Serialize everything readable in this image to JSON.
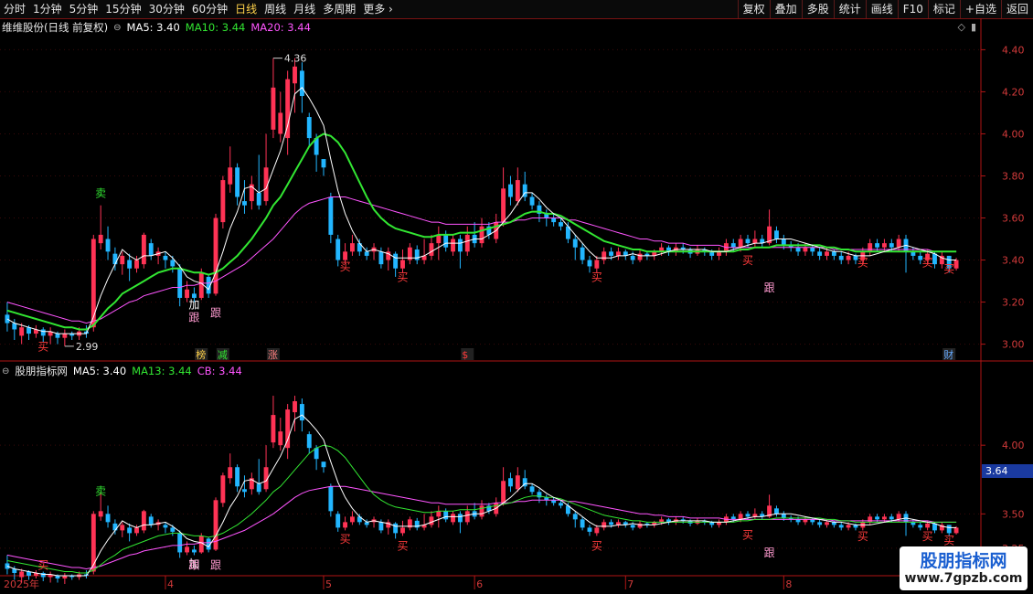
{
  "toolbar": {
    "periods": [
      {
        "label": "分时",
        "active": false
      },
      {
        "label": "1分钟",
        "active": false
      },
      {
        "label": "5分钟",
        "active": false
      },
      {
        "label": "15分钟",
        "active": false
      },
      {
        "label": "30分钟",
        "active": false
      },
      {
        "label": "60分钟",
        "active": false
      },
      {
        "label": "日线",
        "active": true
      },
      {
        "label": "周线",
        "active": false
      },
      {
        "label": "月线",
        "active": false
      },
      {
        "label": "多周期",
        "active": false
      },
      {
        "label": "更多",
        "active": false
      }
    ],
    "actions": [
      "复权",
      "叠加",
      "多股",
      "统计",
      "画线",
      "F10",
      "标记",
      "+自选",
      "返回"
    ]
  },
  "main_panel": {
    "title": "维维股份(日线 前复权)",
    "ma5": "MA5: 3.40",
    "ma10": "MA10: 3.44",
    "ma20": "MA20: 3.44",
    "price_ticks": [
      "4.40",
      "4.20",
      "4.00",
      "3.80",
      "3.60",
      "3.40",
      "3.20",
      "3.00"
    ],
    "high_label": "4.36",
    "low_label": "2.99",
    "event_markers": [
      {
        "text": "榜",
        "color": "#ffd24a"
      },
      {
        "text": "减",
        "color": "#32e632"
      },
      {
        "text": "涨",
        "color": "#ff8080"
      },
      {
        "text": "$",
        "color": "#ff3b3b"
      },
      {
        "text": "财",
        "color": "#66aaff"
      }
    ]
  },
  "sub_panel": {
    "title": "股朋指标网",
    "ma5": "MA5: 3.40",
    "ma13": "MA13: 3.44",
    "cb": "CB: 3.44",
    "price_ticks": [
      "4.00",
      "3.50",
      "3.25"
    ],
    "current_price_tag": "3.64"
  },
  "signals": {
    "buy": "买",
    "sell": "卖",
    "add": "加",
    "follow": "跟"
  },
  "x_axis": {
    "labels": [
      "2025年",
      "4",
      "5",
      "6",
      "7",
      "8"
    ]
  },
  "logo": {
    "name": "股朋指标网",
    "url_text": "www.7gpzb.com"
  },
  "colors": {
    "up": "#ff3355",
    "down": "#22b6ff",
    "ma5": "#ffffff",
    "ma10": "#32e632",
    "ma20": "#ff55ff",
    "axis": "#b01515"
  },
  "chart_data": {
    "type": "candlestick",
    "axis_range": {
      "ylim_main": [
        2.92,
        4.48
      ]
    },
    "candles": [
      {
        "o": 3.14,
        "c": 3.1,
        "h": 3.2,
        "l": 3.06
      },
      {
        "o": 3.1,
        "c": 3.07,
        "h": 3.12,
        "l": 3.02
      },
      {
        "o": 3.04,
        "c": 3.08,
        "h": 3.1,
        "l": 3.0
      },
      {
        "o": 3.08,
        "c": 3.05,
        "h": 3.09,
        "l": 3.02
      },
      {
        "o": 3.05,
        "c": 3.07,
        "h": 3.09,
        "l": 3.03
      },
      {
        "o": 3.07,
        "c": 3.04,
        "h": 3.08,
        "l": 3.01
      },
      {
        "o": 3.04,
        "c": 3.06,
        "h": 3.08,
        "l": 3.0
      },
      {
        "o": 3.05,
        "c": 3.03,
        "h": 3.06,
        "l": 3.0
      },
      {
        "o": 3.03,
        "c": 3.05,
        "h": 3.07,
        "l": 2.99
      },
      {
        "o": 3.05,
        "c": 3.04,
        "h": 3.06,
        "l": 3.02
      },
      {
        "o": 3.04,
        "c": 3.06,
        "h": 3.08,
        "l": 3.02
      },
      {
        "o": 3.06,
        "c": 3.05,
        "h": 3.09,
        "l": 3.03
      },
      {
        "o": 3.08,
        "c": 3.5,
        "h": 3.52,
        "l": 3.06
      },
      {
        "o": 3.48,
        "c": 3.52,
        "h": 3.66,
        "l": 3.45
      },
      {
        "o": 3.5,
        "c": 3.44,
        "h": 3.56,
        "l": 3.4
      },
      {
        "o": 3.43,
        "c": 3.38,
        "h": 3.46,
        "l": 3.35
      },
      {
        "o": 3.38,
        "c": 3.42,
        "h": 3.44,
        "l": 3.33
      },
      {
        "o": 3.4,
        "c": 3.36,
        "h": 3.43,
        "l": 3.3
      },
      {
        "o": 3.36,
        "c": 3.4,
        "h": 3.42,
        "l": 3.34
      },
      {
        "o": 3.38,
        "c": 3.52,
        "h": 3.53,
        "l": 3.36
      },
      {
        "o": 3.48,
        "c": 3.42,
        "h": 3.5,
        "l": 3.4
      },
      {
        "o": 3.42,
        "c": 3.44,
        "h": 3.46,
        "l": 3.38
      },
      {
        "o": 3.42,
        "c": 3.4,
        "h": 3.44,
        "l": 3.36
      },
      {
        "o": 3.4,
        "c": 3.37,
        "h": 3.42,
        "l": 3.34
      },
      {
        "o": 3.36,
        "c": 3.22,
        "h": 3.38,
        "l": 3.18
      },
      {
        "o": 3.22,
        "c": 3.26,
        "h": 3.3,
        "l": 3.2
      },
      {
        "o": 3.24,
        "c": 3.22,
        "h": 3.27,
        "l": 3.2
      },
      {
        "o": 3.22,
        "c": 3.34,
        "h": 3.36,
        "l": 3.21
      },
      {
        "o": 3.32,
        "c": 3.24,
        "h": 3.33,
        "l": 3.22
      },
      {
        "o": 3.24,
        "c": 3.6,
        "h": 3.62,
        "l": 3.23
      },
      {
        "o": 3.58,
        "c": 3.78,
        "h": 3.8,
        "l": 3.55
      },
      {
        "o": 3.76,
        "c": 3.84,
        "h": 3.94,
        "l": 3.72
      },
      {
        "o": 3.84,
        "c": 3.7,
        "h": 3.86,
        "l": 3.66
      },
      {
        "o": 3.68,
        "c": 3.66,
        "h": 3.78,
        "l": 3.62
      },
      {
        "o": 3.68,
        "c": 3.76,
        "h": 3.8,
        "l": 3.64
      },
      {
        "o": 3.72,
        "c": 3.66,
        "h": 3.9,
        "l": 3.64
      },
      {
        "o": 3.68,
        "c": 3.84,
        "h": 4.0,
        "l": 3.66
      },
      {
        "o": 4.02,
        "c": 4.22,
        "h": 4.36,
        "l": 3.98
      },
      {
        "o": 4.0,
        "c": 4.1,
        "h": 4.2,
        "l": 3.96
      },
      {
        "o": 3.98,
        "c": 4.26,
        "h": 4.3,
        "l": 3.9
      },
      {
        "o": 4.24,
        "c": 4.32,
        "h": 4.36,
        "l": 4.1
      },
      {
        "o": 4.3,
        "c": 4.18,
        "h": 4.34,
        "l": 4.1
      },
      {
        "o": 4.08,
        "c": 3.98,
        "h": 4.1,
        "l": 3.94
      },
      {
        "o": 3.98,
        "c": 3.9,
        "h": 4.0,
        "l": 3.82
      },
      {
        "o": 3.88,
        "c": 3.84,
        "h": 3.88,
        "l": 3.8
      },
      {
        "o": 3.7,
        "c": 3.52,
        "h": 3.72,
        "l": 3.48
      },
      {
        "o": 3.5,
        "c": 3.4,
        "h": 3.52,
        "l": 3.37
      },
      {
        "o": 3.4,
        "c": 3.44,
        "h": 3.48,
        "l": 3.38
      },
      {
        "o": 3.44,
        "c": 3.48,
        "h": 3.52,
        "l": 3.42
      },
      {
        "o": 3.48,
        "c": 3.44,
        "h": 3.5,
        "l": 3.42
      },
      {
        "o": 3.44,
        "c": 3.42,
        "h": 3.46,
        "l": 3.4
      },
      {
        "o": 3.44,
        "c": 3.46,
        "h": 3.48,
        "l": 3.4
      },
      {
        "o": 3.44,
        "c": 3.38,
        "h": 3.46,
        "l": 3.36
      },
      {
        "o": 3.4,
        "c": 3.44,
        "h": 3.46,
        "l": 3.35
      },
      {
        "o": 3.43,
        "c": 3.36,
        "h": 3.44,
        "l": 3.32
      },
      {
        "o": 3.36,
        "c": 3.4,
        "h": 3.45,
        "l": 3.34
      },
      {
        "o": 3.4,
        "c": 3.46,
        "h": 3.48,
        "l": 3.38
      },
      {
        "o": 3.45,
        "c": 3.4,
        "h": 3.47,
        "l": 3.38
      },
      {
        "o": 3.4,
        "c": 3.42,
        "h": 3.5,
        "l": 3.38
      },
      {
        "o": 3.42,
        "c": 3.48,
        "h": 3.52,
        "l": 3.4
      },
      {
        "o": 3.48,
        "c": 3.52,
        "h": 3.56,
        "l": 3.4
      },
      {
        "o": 3.52,
        "c": 3.46,
        "h": 3.54,
        "l": 3.44
      },
      {
        "o": 3.44,
        "c": 3.5,
        "h": 3.52,
        "l": 3.42
      },
      {
        "o": 3.5,
        "c": 3.44,
        "h": 3.52,
        "l": 3.36
      },
      {
        "o": 3.44,
        "c": 3.52,
        "h": 3.56,
        "l": 3.42
      },
      {
        "o": 3.52,
        "c": 3.48,
        "h": 3.58,
        "l": 3.46
      },
      {
        "o": 3.48,
        "c": 3.56,
        "h": 3.6,
        "l": 3.46
      },
      {
        "o": 3.56,
        "c": 3.52,
        "h": 3.58,
        "l": 3.5
      },
      {
        "o": 3.5,
        "c": 3.58,
        "h": 3.62,
        "l": 3.48
      },
      {
        "o": 3.58,
        "c": 3.74,
        "h": 3.84,
        "l": 3.56
      },
      {
        "o": 3.76,
        "c": 3.7,
        "h": 3.8,
        "l": 3.66
      },
      {
        "o": 3.68,
        "c": 3.78,
        "h": 3.84,
        "l": 3.66
      },
      {
        "o": 3.76,
        "c": 3.7,
        "h": 3.82,
        "l": 3.68
      },
      {
        "o": 3.7,
        "c": 3.66,
        "h": 3.72,
        "l": 3.64
      },
      {
        "o": 3.66,
        "c": 3.62,
        "h": 3.68,
        "l": 3.58
      },
      {
        "o": 3.62,
        "c": 3.6,
        "h": 3.64,
        "l": 3.56
      },
      {
        "o": 3.6,
        "c": 3.58,
        "h": 3.62,
        "l": 3.56
      },
      {
        "o": 3.58,
        "c": 3.56,
        "h": 3.6,
        "l": 3.54
      },
      {
        "o": 3.56,
        "c": 3.5,
        "h": 3.58,
        "l": 3.48
      },
      {
        "o": 3.5,
        "c": 3.46,
        "h": 3.52,
        "l": 3.4
      },
      {
        "o": 3.46,
        "c": 3.4,
        "h": 3.48,
        "l": 3.38
      },
      {
        "o": 3.4,
        "c": 3.37,
        "h": 3.42,
        "l": 3.34
      },
      {
        "o": 3.36,
        "c": 3.4,
        "h": 3.42,
        "l": 3.34
      },
      {
        "o": 3.4,
        "c": 3.44,
        "h": 3.46,
        "l": 3.38
      },
      {
        "o": 3.44,
        "c": 3.42,
        "h": 3.46,
        "l": 3.4
      },
      {
        "o": 3.42,
        "c": 3.44,
        "h": 3.46,
        "l": 3.4
      },
      {
        "o": 3.44,
        "c": 3.42,
        "h": 3.45,
        "l": 3.4
      },
      {
        "o": 3.42,
        "c": 3.4,
        "h": 3.44,
        "l": 3.38
      },
      {
        "o": 3.4,
        "c": 3.43,
        "h": 3.45,
        "l": 3.39
      },
      {
        "o": 3.43,
        "c": 3.42,
        "h": 3.44,
        "l": 3.4
      },
      {
        "o": 3.42,
        "c": 3.44,
        "h": 3.45,
        "l": 3.4
      },
      {
        "o": 3.44,
        "c": 3.46,
        "h": 3.48,
        "l": 3.42
      },
      {
        "o": 3.46,
        "c": 3.44,
        "h": 3.47,
        "l": 3.42
      },
      {
        "o": 3.44,
        "c": 3.46,
        "h": 3.48,
        "l": 3.42
      },
      {
        "o": 3.46,
        "c": 3.45,
        "h": 3.48,
        "l": 3.43
      },
      {
        "o": 3.45,
        "c": 3.43,
        "h": 3.46,
        "l": 3.41
      },
      {
        "o": 3.43,
        "c": 3.45,
        "h": 3.47,
        "l": 3.42
      },
      {
        "o": 3.45,
        "c": 3.44,
        "h": 3.46,
        "l": 3.42
      },
      {
        "o": 3.44,
        "c": 3.42,
        "h": 3.45,
        "l": 3.4
      },
      {
        "o": 3.42,
        "c": 3.44,
        "h": 3.46,
        "l": 3.4
      },
      {
        "o": 3.44,
        "c": 3.48,
        "h": 3.5,
        "l": 3.42
      },
      {
        "o": 3.48,
        "c": 3.46,
        "h": 3.5,
        "l": 3.44
      },
      {
        "o": 3.46,
        "c": 3.5,
        "h": 3.52,
        "l": 3.44
      },
      {
        "o": 3.5,
        "c": 3.48,
        "h": 3.52,
        "l": 3.46
      },
      {
        "o": 3.48,
        "c": 3.5,
        "h": 3.54,
        "l": 3.46
      },
      {
        "o": 3.5,
        "c": 3.48,
        "h": 3.52,
        "l": 3.46
      },
      {
        "o": 3.48,
        "c": 3.56,
        "h": 3.64,
        "l": 3.47
      },
      {
        "o": 3.54,
        "c": 3.5,
        "h": 3.56,
        "l": 3.48
      },
      {
        "o": 3.5,
        "c": 3.47,
        "h": 3.52,
        "l": 3.45
      },
      {
        "o": 3.47,
        "c": 3.46,
        "h": 3.49,
        "l": 3.44
      },
      {
        "o": 3.46,
        "c": 3.44,
        "h": 3.48,
        "l": 3.42
      },
      {
        "o": 3.44,
        "c": 3.46,
        "h": 3.48,
        "l": 3.42
      },
      {
        "o": 3.46,
        "c": 3.44,
        "h": 3.47,
        "l": 3.42
      },
      {
        "o": 3.44,
        "c": 3.42,
        "h": 3.46,
        "l": 3.4
      },
      {
        "o": 3.42,
        "c": 3.44,
        "h": 3.46,
        "l": 3.4
      },
      {
        "o": 3.44,
        "c": 3.42,
        "h": 3.45,
        "l": 3.4
      },
      {
        "o": 3.42,
        "c": 3.4,
        "h": 3.44,
        "l": 3.38
      },
      {
        "o": 3.4,
        "c": 3.42,
        "h": 3.44,
        "l": 3.38
      },
      {
        "o": 3.42,
        "c": 3.4,
        "h": 3.43,
        "l": 3.38
      },
      {
        "o": 3.4,
        "c": 3.44,
        "h": 3.46,
        "l": 3.38
      },
      {
        "o": 3.44,
        "c": 3.48,
        "h": 3.5,
        "l": 3.42
      },
      {
        "o": 3.48,
        "c": 3.46,
        "h": 3.5,
        "l": 3.44
      },
      {
        "o": 3.46,
        "c": 3.48,
        "h": 3.5,
        "l": 3.44
      },
      {
        "o": 3.48,
        "c": 3.46,
        "h": 3.5,
        "l": 3.44
      },
      {
        "o": 3.46,
        "c": 3.5,
        "h": 3.52,
        "l": 3.44
      },
      {
        "o": 3.5,
        "c": 3.44,
        "h": 3.52,
        "l": 3.34
      },
      {
        "o": 3.44,
        "c": 3.42,
        "h": 3.46,
        "l": 3.4
      },
      {
        "o": 3.42,
        "c": 3.4,
        "h": 3.44,
        "l": 3.38
      },
      {
        "o": 3.4,
        "c": 3.43,
        "h": 3.45,
        "l": 3.38
      },
      {
        "o": 3.43,
        "c": 3.38,
        "h": 3.44,
        "l": 3.36
      },
      {
        "o": 3.38,
        "c": 3.42,
        "h": 3.44,
        "l": 3.36
      },
      {
        "o": 3.42,
        "c": 3.36,
        "h": 3.42,
        "l": 3.34
      },
      {
        "o": 3.36,
        "c": 3.4,
        "h": 3.41,
        "l": 3.35
      }
    ],
    "ma5_values": [
      3.12,
      3.1,
      3.09,
      3.08,
      3.07,
      3.06,
      3.06,
      3.05,
      3.05,
      3.05,
      3.05,
      3.05,
      3.13,
      3.23,
      3.31,
      3.38,
      3.45,
      3.42,
      3.4,
      3.42,
      3.42,
      3.43,
      3.44,
      3.41,
      3.37,
      3.32,
      3.3,
      3.29,
      3.26,
      3.34,
      3.44,
      3.55,
      3.63,
      3.74,
      3.75,
      3.72,
      3.74,
      3.83,
      3.92,
      4.04,
      4.19,
      4.22,
      4.17,
      4.11,
      4.04,
      3.88,
      3.73,
      3.62,
      3.54,
      3.48,
      3.44,
      3.45,
      3.44,
      3.43,
      3.41,
      3.41,
      3.41,
      3.41,
      3.42,
      3.44,
      3.46,
      3.48,
      3.48,
      3.48,
      3.49,
      3.5,
      3.5,
      3.52,
      3.54,
      3.58,
      3.62,
      3.67,
      3.72,
      3.72,
      3.69,
      3.65,
      3.62,
      3.6,
      3.56,
      3.52,
      3.48,
      3.44,
      3.41,
      3.41,
      3.41,
      3.42,
      3.42,
      3.43,
      3.42,
      3.42,
      3.42,
      3.43,
      3.44,
      3.45,
      3.45,
      3.45,
      3.45,
      3.45,
      3.44,
      3.44,
      3.44,
      3.45,
      3.46,
      3.47,
      3.48,
      3.48,
      3.49,
      3.5,
      3.5,
      3.5,
      3.49,
      3.48,
      3.47,
      3.46,
      3.45,
      3.44,
      3.44,
      3.43,
      3.42,
      3.42,
      3.42,
      3.43,
      3.44,
      3.45,
      3.46,
      3.47,
      3.46,
      3.45,
      3.44,
      3.43,
      3.41,
      3.4,
      3.4
    ],
    "ma10_values": [
      3.16,
      3.15,
      3.14,
      3.13,
      3.12,
      3.11,
      3.1,
      3.09,
      3.08,
      3.08,
      3.07,
      3.07,
      3.09,
      3.13,
      3.17,
      3.2,
      3.24,
      3.26,
      3.28,
      3.3,
      3.32,
      3.34,
      3.35,
      3.36,
      3.36,
      3.35,
      3.34,
      3.34,
      3.33,
      3.34,
      3.36,
      3.39,
      3.42,
      3.46,
      3.5,
      3.55,
      3.6,
      3.66,
      3.7,
      3.76,
      3.82,
      3.88,
      3.94,
      3.98,
      4.0,
      3.99,
      3.96,
      3.91,
      3.84,
      3.77,
      3.7,
      3.64,
      3.6,
      3.57,
      3.55,
      3.54,
      3.53,
      3.52,
      3.51,
      3.51,
      3.52,
      3.52,
      3.52,
      3.53,
      3.53,
      3.53,
      3.54,
      3.55,
      3.56,
      3.57,
      3.58,
      3.6,
      3.62,
      3.63,
      3.63,
      3.62,
      3.62,
      3.61,
      3.59,
      3.57,
      3.55,
      3.53,
      3.51,
      3.49,
      3.48,
      3.47,
      3.46,
      3.45,
      3.45,
      3.44,
      3.44,
      3.44,
      3.44,
      3.44,
      3.44,
      3.44,
      3.44,
      3.44,
      3.44,
      3.44,
      3.44,
      3.44,
      3.45,
      3.45,
      3.46,
      3.46,
      3.46,
      3.47,
      3.47,
      3.47,
      3.47,
      3.47,
      3.47,
      3.47,
      3.46,
      3.46,
      3.45,
      3.45,
      3.44,
      3.44,
      3.44,
      3.44,
      3.44,
      3.44,
      3.44,
      3.44,
      3.44,
      3.44,
      3.44,
      3.44,
      3.44,
      3.44,
      3.44
    ],
    "ma20_values": [
      3.2,
      3.19,
      3.18,
      3.17,
      3.16,
      3.15,
      3.14,
      3.13,
      3.12,
      3.11,
      3.11,
      3.1,
      3.11,
      3.12,
      3.14,
      3.16,
      3.18,
      3.2,
      3.21,
      3.23,
      3.24,
      3.25,
      3.26,
      3.27,
      3.27,
      3.28,
      3.28,
      3.29,
      3.29,
      3.3,
      3.32,
      3.34,
      3.36,
      3.38,
      3.41,
      3.44,
      3.47,
      3.5,
      3.54,
      3.58,
      3.62,
      3.65,
      3.67,
      3.68,
      3.69,
      3.7,
      3.7,
      3.7,
      3.69,
      3.68,
      3.67,
      3.66,
      3.65,
      3.64,
      3.63,
      3.62,
      3.61,
      3.6,
      3.59,
      3.58,
      3.58,
      3.57,
      3.57,
      3.57,
      3.57,
      3.57,
      3.57,
      3.57,
      3.58,
      3.58,
      3.58,
      3.59,
      3.59,
      3.6,
      3.6,
      3.6,
      3.6,
      3.6,
      3.59,
      3.59,
      3.58,
      3.57,
      3.56,
      3.55,
      3.54,
      3.53,
      3.52,
      3.51,
      3.5,
      3.5,
      3.49,
      3.49,
      3.48,
      3.48,
      3.48,
      3.47,
      3.47,
      3.47,
      3.47,
      3.47,
      3.46,
      3.46,
      3.46,
      3.46,
      3.46,
      3.46,
      3.46,
      3.46,
      3.46,
      3.46,
      3.46,
      3.46,
      3.46,
      3.46,
      3.46,
      3.45,
      3.45,
      3.45,
      3.45,
      3.45,
      3.45,
      3.45,
      3.45,
      3.45,
      3.45,
      3.45,
      3.45,
      3.45,
      3.45,
      3.44,
      3.44,
      3.44,
      3.44
    ]
  }
}
